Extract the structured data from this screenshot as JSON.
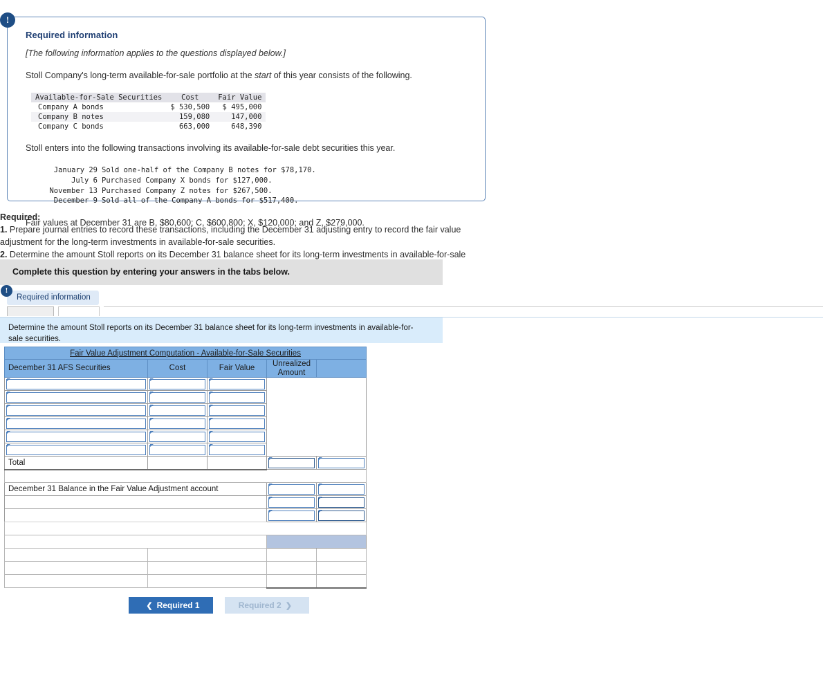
{
  "panel": {
    "badge_icon": "exclamation-icon",
    "title": "Required information",
    "applies_note": "[The following information applies to the questions displayed below.]",
    "intro_before": "Stoll Company's long-term available-for-sale portfolio at the ",
    "intro_italic": "start",
    "intro_after": " of this year consists of the following.",
    "securities_table": {
      "headers": [
        "Available-for-Sale Securities",
        "Cost",
        "Fair Value"
      ],
      "rows": [
        [
          "Company A bonds",
          "$ 530,500",
          "$ 495,000"
        ],
        [
          "Company B notes",
          "159,080",
          "147,000"
        ],
        [
          "Company C bonds",
          "663,000",
          "648,390"
        ]
      ]
    },
    "transactions_intro": "Stoll enters into the following transactions involving its available-for-sale debt securities this year.",
    "transactions": [
      {
        "date": "January 29",
        "desc": "Sold one-half of the Company B notes for $78,170."
      },
      {
        "date": "July 6",
        "desc": "Purchased Company X bonds for $127,000."
      },
      {
        "date": "November 13",
        "desc": "Purchased Company Z notes for $267,500."
      },
      {
        "date": "December 9",
        "desc": "Sold all of the Company A bonds for $517,400."
      }
    ],
    "fair_values_note": "Fair values at December 31 are B, $80,600; C, $600,800; X, $120,000; and Z, $279,000."
  },
  "required": {
    "heading": "Required:",
    "item1_num": "1.",
    "item1_text": " Prepare journal entries to record these transactions, including the December 31 adjusting entry to record the fair value adjustment for the long-term investments in available-for-sale securities.",
    "item2_num": "2.",
    "item2_text": " Determine the amount Stoll reports on its December 31 balance sheet for its long-term investments in available-for-sale securities."
  },
  "complete_banner": {
    "text": "Complete this question by entering your answers in the tabs below."
  },
  "required_info_pill": {
    "badge_icon": "exclamation-icon",
    "label": "Required information"
  },
  "tabs": [
    {
      "label": "",
      "state": "inactive"
    },
    {
      "label": "",
      "state": "active"
    }
  ],
  "question_banner": {
    "text": "Determine the amount Stoll reports on its December 31 balance sheet for its long-term investments in available-for-sale securities."
  },
  "worksheet": {
    "title": "Fair Value Adjustment Computation - Available-for-Sale Securities",
    "headers": [
      "December 31 AFS Securities",
      "Cost",
      "Fair Value",
      "Unrealized Amount",
      ""
    ],
    "entry_rows": [
      {
        "security": "",
        "cost": "",
        "fair_value": ""
      },
      {
        "security": "",
        "cost": "",
        "fair_value": ""
      },
      {
        "security": "",
        "cost": "",
        "fair_value": ""
      },
      {
        "security": "",
        "cost": "",
        "fair_value": ""
      },
      {
        "security": "",
        "cost": "",
        "fair_value": ""
      },
      {
        "security": "",
        "cost": "",
        "fair_value": ""
      }
    ],
    "total_row": {
      "label": "Total",
      "cost": "",
      "fair_value": "",
      "unrealized": "",
      "extra": ""
    },
    "balance_row": {
      "label": "December 31 Balance in the Fair Value Adjustment account",
      "unrealized": "",
      "extra": ""
    },
    "balance_extra_rows": [
      {
        "label": "",
        "unrealized": "",
        "extra": ""
      },
      {
        "label": "",
        "unrealized": "",
        "extra": ""
      }
    ],
    "bottom_rows": [
      {
        "c1": "",
        "c2": "",
        "c3": "",
        "c4": ""
      },
      {
        "c1": "",
        "c2": "",
        "c3": "",
        "c4": ""
      },
      {
        "c1": "",
        "c2": "",
        "c3": "",
        "c4": ""
      }
    ]
  },
  "footer": {
    "prev_label": "Required 1",
    "prev_icon": "chevron-left-icon",
    "next_label": "Required 2",
    "next_icon": "chevron-right-icon"
  },
  "colors": {
    "panel_border": "#5f87b8",
    "title_blue": "#1f3f73",
    "badge_blue": "#1f4e85",
    "banner_grey": "#e0e0e0",
    "banner_blue": "#d9ecfb",
    "header_blue": "#7eb0e3",
    "shade_blue": "#b3c4e0",
    "input_border": "#4f81bd",
    "btn_primary": "#2f6db5",
    "btn_disabled": "#d5e3f2"
  }
}
